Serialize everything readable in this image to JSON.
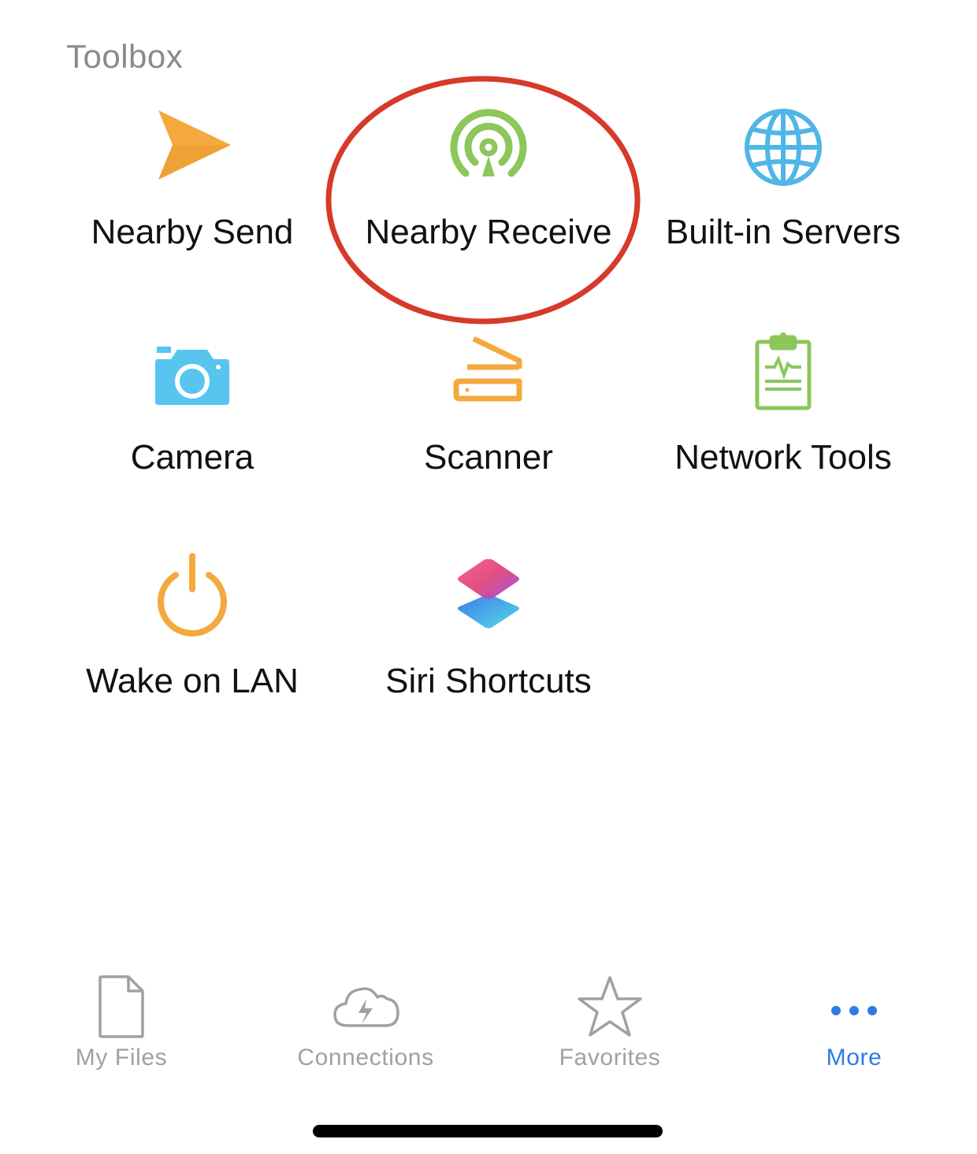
{
  "toolbox": {
    "title": "Toolbox",
    "items": [
      {
        "label": "Nearby Send",
        "icon": "paper-plane-icon",
        "color": "#F4A93E"
      },
      {
        "label": "Nearby Receive",
        "icon": "airdrop-icon",
        "color": "#8BC75A",
        "highlighted": true
      },
      {
        "label": "Built-in Servers",
        "icon": "globe-icon",
        "color": "#4FB6E6"
      },
      {
        "label": "Camera",
        "icon": "camera-icon",
        "color": "#58C4F0"
      },
      {
        "label": "Scanner",
        "icon": "scanner-icon",
        "color": "#F4A93E"
      },
      {
        "label": "Network Tools",
        "icon": "clipboard-pulse-icon",
        "color": "#8BC75A"
      },
      {
        "label": "Wake on LAN",
        "icon": "power-icon",
        "color": "#F4A93E"
      },
      {
        "label": "Siri Shortcuts",
        "icon": "shortcuts-icon",
        "color": "#E0457B"
      }
    ]
  },
  "annotation": {
    "color": "#D63A2A"
  },
  "tabbar": {
    "tabs": [
      {
        "label": "My Files",
        "icon": "file-icon",
        "active": false
      },
      {
        "label": "Connections",
        "icon": "cloud-bolt-icon",
        "active": false
      },
      {
        "label": "Favorites",
        "icon": "star-icon",
        "active": false
      },
      {
        "label": "More",
        "icon": "more-dots-icon",
        "active": true
      }
    ],
    "inactive_color": "#A0A0A5",
    "active_color": "#2F7BE6"
  }
}
